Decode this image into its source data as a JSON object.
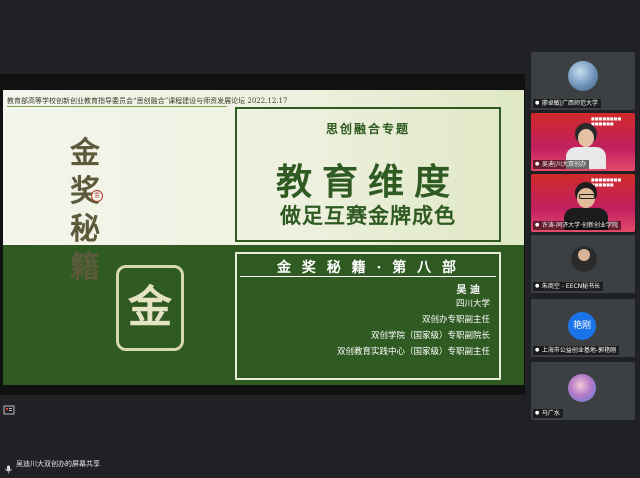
{
  "slide": {
    "header": "教育部高等学校创新创业教育指导委员会“思创融合”课程建设与师资发展论坛 2022.12.17",
    "calligraphy": [
      "金",
      "奖",
      "秘",
      "籍"
    ],
    "small_seal": "金",
    "stamp": "金",
    "topic": "思创融合专题",
    "title_line1": "教育维度",
    "title_line2": "做足互赛金牌成色",
    "part": "金 奖 秘 籍 · 第 八 部",
    "speaker_name": "吴 迪",
    "university": "四川大学",
    "roles": [
      "双创办专职副主任",
      "双创学院（国家级）专职副院长",
      "双创教育实践中心（国家级）专职副主任"
    ]
  },
  "participants": [
    {
      "name": "廖卓敏|广西师范大学",
      "type": "avatar"
    },
    {
      "name": "吴迪|川大双创办",
      "type": "video"
    },
    {
      "name": "许涛-同济大学·创新创业学院",
      "type": "video"
    },
    {
      "name": "朱商空 - EECN秘书长",
      "type": "avatar"
    },
    {
      "name": "上海市公益创业基地-郭艳刚",
      "type": "avatar",
      "avatar_text": "艳刚"
    },
    {
      "name": "马广水",
      "type": "avatar"
    }
  ],
  "share_status": "吴迪川大双创办的屏幕共享",
  "colors": {
    "background": "#202124",
    "slide_green": "#2f5a21",
    "tile": "#3c4043",
    "accent_blue": "#1a73e8"
  }
}
